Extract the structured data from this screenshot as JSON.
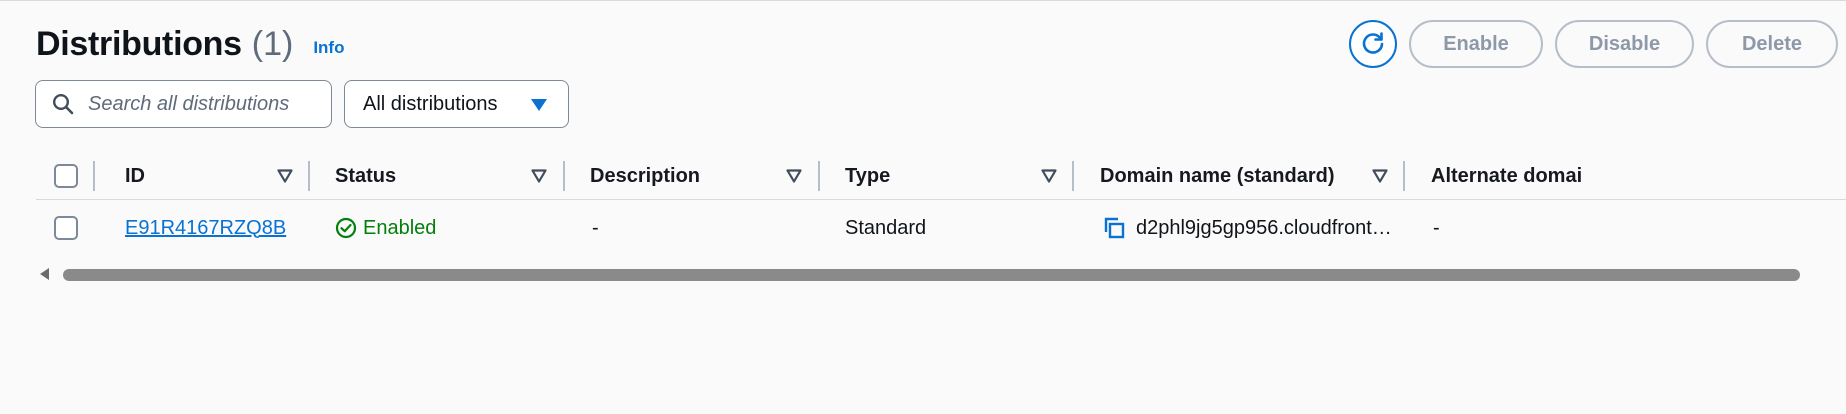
{
  "header": {
    "title": "Distributions",
    "count": "(1)",
    "info_label": "Info"
  },
  "actions": {
    "refresh_icon": "refresh-icon",
    "enable_label": "Enable",
    "disable_label": "Disable",
    "delete_label": "Delete"
  },
  "filters": {
    "search_placeholder": "Search all distributions",
    "search_value": "",
    "select_value": "All distributions"
  },
  "table": {
    "columns": [
      "ID",
      "Status",
      "Description",
      "Type",
      "Domain name (standard)",
      "Alternate domai"
    ],
    "rows": [
      {
        "id": "E91R4167RZQ8B",
        "status": "Enabled",
        "description": "-",
        "type": "Standard",
        "domain": "d2phl9jg5gp956.cloudfront…",
        "alternate": "-"
      }
    ]
  },
  "colors": {
    "link": "#0972d3",
    "success": "#037f0c",
    "disabled_text": "#8d99a8"
  }
}
